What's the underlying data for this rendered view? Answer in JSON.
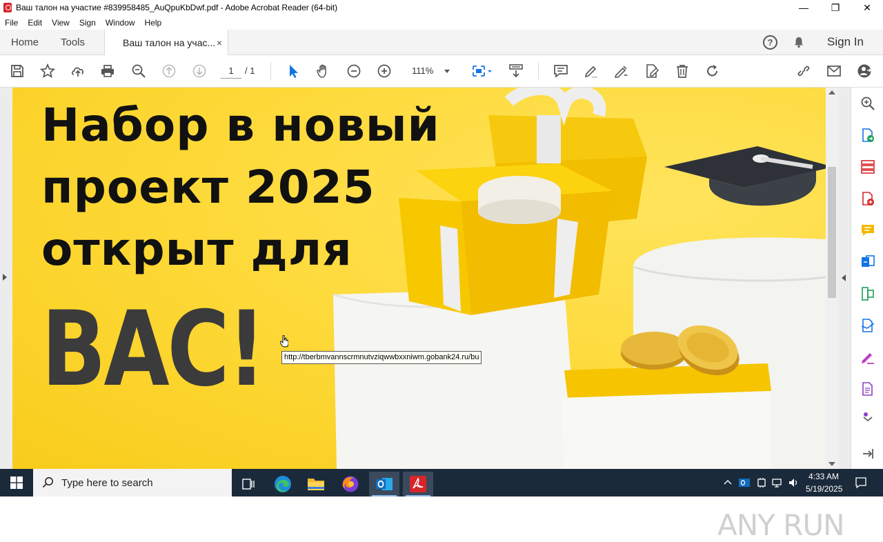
{
  "window": {
    "title": "Ваш талон на участие #839958485_AuQpuKbDwf.pdf - Adobe Acrobat Reader (64-bit)",
    "minimize": "—",
    "maximize": "❐",
    "close": "✕"
  },
  "menu": [
    "File",
    "Edit",
    "View",
    "Sign",
    "Window",
    "Help"
  ],
  "tabs": {
    "home": "Home",
    "tools": "Tools",
    "document": "Ваш талон на учас...",
    "close": "×",
    "help": "?",
    "sign_in": "Sign In"
  },
  "toolbar": {
    "page_current": "1",
    "page_total": "/ 1",
    "zoom": "111%"
  },
  "document": {
    "headline_line1": "Набор в новый",
    "headline_line2": "проект 2025",
    "headline_line3": "открыт для",
    "big_text": "ВАС!",
    "link_tooltip": "http://tberbmvannscrmnutvziqwwbxxniwm.gobank24.ru/bu",
    "watermark": "ANY RUN"
  },
  "taskbar": {
    "search_placeholder": "Type here to search",
    "time": "4:33 AM",
    "date": "5/19/2025"
  },
  "colors": {
    "page_yellow": "#fdd835",
    "acrobat_red": "#d7262a",
    "toolbar_blue": "#1473e6",
    "taskbar_bg": "#1b2a3a"
  }
}
